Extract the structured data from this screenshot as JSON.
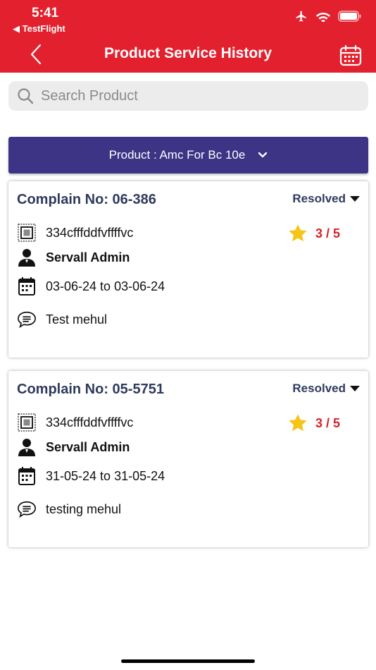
{
  "status_bar": {
    "time": "5:41",
    "back_app": "◀ TestFlight"
  },
  "header": {
    "title": "Product Service History"
  },
  "search": {
    "placeholder": "Search Product"
  },
  "product_selector": {
    "label": "Product : Amc For Bc 10e"
  },
  "colors": {
    "header": "#e3202d",
    "product_bar": "#3d3486",
    "rating": "#d3232c",
    "star": "#f5c518",
    "heading_text": "#2f3a5d"
  },
  "complaints": [
    {
      "number": "Complain No: 06-386",
      "status": "Resolved",
      "serial": "334cfffddfvffffvc",
      "rating": "3 / 5",
      "engineer": "Servall Admin",
      "dates": "03-06-24 to 03-06-24",
      "remark": "Test mehul"
    },
    {
      "number": "Complain No: 05-5751",
      "status": "Resolved",
      "serial": "334cfffddfvffffvc",
      "rating": "3 / 5",
      "engineer": "Servall Admin",
      "dates": "31-05-24 to 31-05-24",
      "remark": "testing mehul"
    }
  ]
}
